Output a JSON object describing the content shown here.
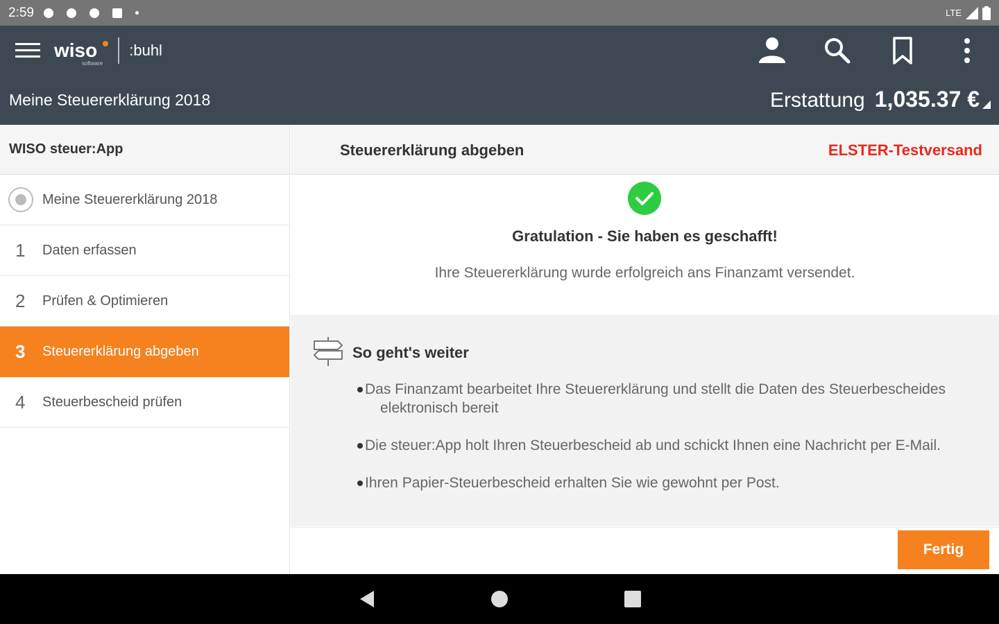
{
  "status_bar": {
    "time": "2:59",
    "network": "LTE"
  },
  "app_bar": {
    "brand": "wiso",
    "brand_sub": "software",
    "partner": ":buhl"
  },
  "sub_bar": {
    "title": "Meine Steuererklärung 2018",
    "refund_label": "Erstattung",
    "refund_value": "1,035.37 €"
  },
  "sidebar": {
    "header": "WISO steuer:App",
    "items": [
      {
        "num": "",
        "label": "Meine Steuererklärung 2018"
      },
      {
        "num": "1",
        "label": "Daten erfassen"
      },
      {
        "num": "2",
        "label": "Prüfen & Optimieren"
      },
      {
        "num": "3",
        "label": "Steuererklärung abgeben"
      },
      {
        "num": "4",
        "label": "Steuerbescheid prüfen"
      }
    ],
    "active_index": 3
  },
  "content": {
    "title": "Steuererklärung abgeben",
    "badge": "ELSTER-Testversand",
    "badge_color": "#e8291c",
    "congrats": "Gratulation - Sie haben es geschafft!",
    "sent_message": "Ihre Steuererklärung wurde erfolgreich ans Finanzamt versendet.",
    "next_heading": "So geht's weiter",
    "bullets": [
      "Das Finanzamt bearbeitet Ihre Steuererklärung und stellt die Daten des Steuerbescheides elektronisch bereit",
      "Die steuer:App holt Ihren Steuerbescheid ab und schickt Ihnen eine Nachricht per E-Mail.",
      "Ihren Papier-Steuerbescheid erhalten Sie wie gewohnt per Post."
    ],
    "done_button": "Fertig"
  },
  "colors": {
    "accent": "#f5821f",
    "appbar": "#3d4852",
    "success": "#2ecc40"
  },
  "icons": [
    "menu-icon",
    "user-icon",
    "search-icon",
    "bookmark-icon",
    "more-vert-icon",
    "check-circle-icon",
    "signpost-icon",
    "back-icon",
    "home-icon",
    "recents-icon"
  ]
}
